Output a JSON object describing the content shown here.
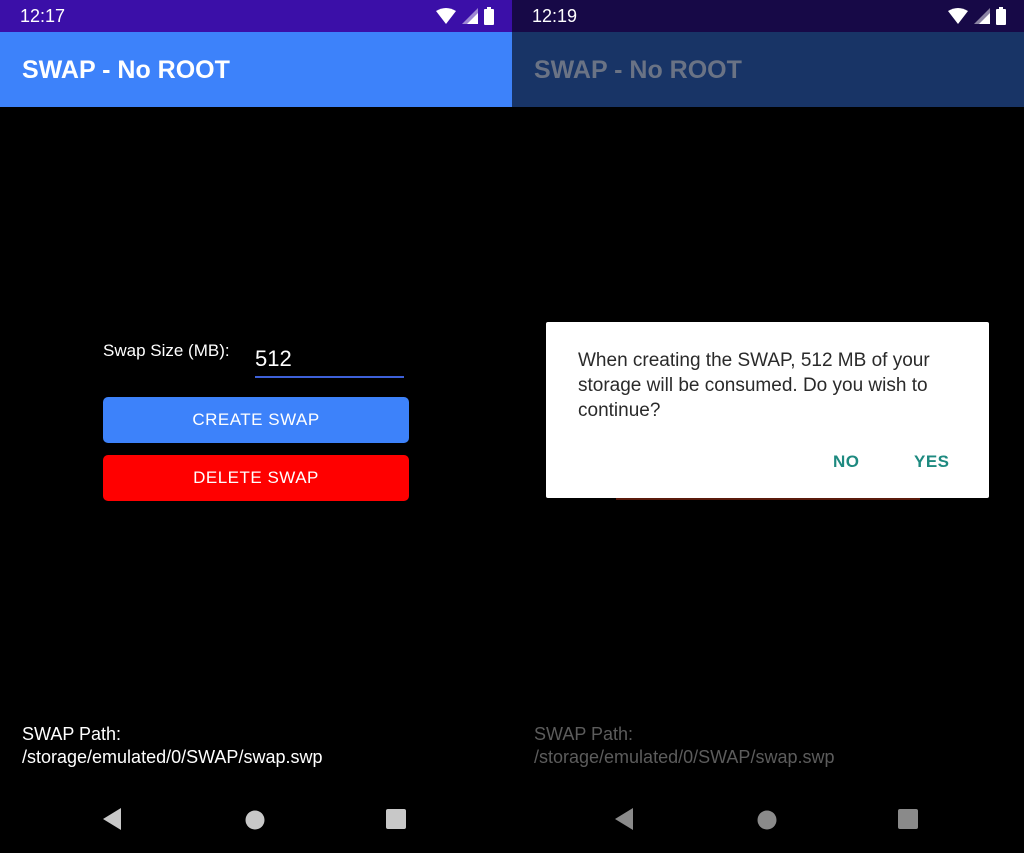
{
  "left": {
    "status_time": "12:17",
    "app_title": "SWAP - No ROOT",
    "swap_size_label": "Swap Size (MB):",
    "swap_size_value": "512",
    "create_button": "CREATE SWAP",
    "delete_button": "DELETE SWAP",
    "path_label": "SWAP Path:",
    "path_value": "/storage/emulated/0/SWAP/swap.swp"
  },
  "right": {
    "status_time": "12:19",
    "app_title": "SWAP - No ROOT",
    "dialog": {
      "message": "When creating the SWAP, 512 MB of your storage will be consumed. Do you wish to continue?",
      "no_button": "NO",
      "yes_button": "YES"
    },
    "path_label": "SWAP Path:",
    "path_value": "/storage/emulated/0/SWAP/swap.swp"
  },
  "icons": {
    "status": [
      "wifi-icon",
      "signal-icon",
      "battery-icon"
    ],
    "nav": [
      "back-icon",
      "home-icon",
      "recents-icon"
    ]
  },
  "colors": {
    "statusbar_left": "#3b0fa8",
    "appbar_left": "#3d82fa",
    "appbar_dimmed": "#183466",
    "create_button": "#3d82fa",
    "delete_button": "#ff0000",
    "dialog_button_text": "#1e8a80"
  }
}
